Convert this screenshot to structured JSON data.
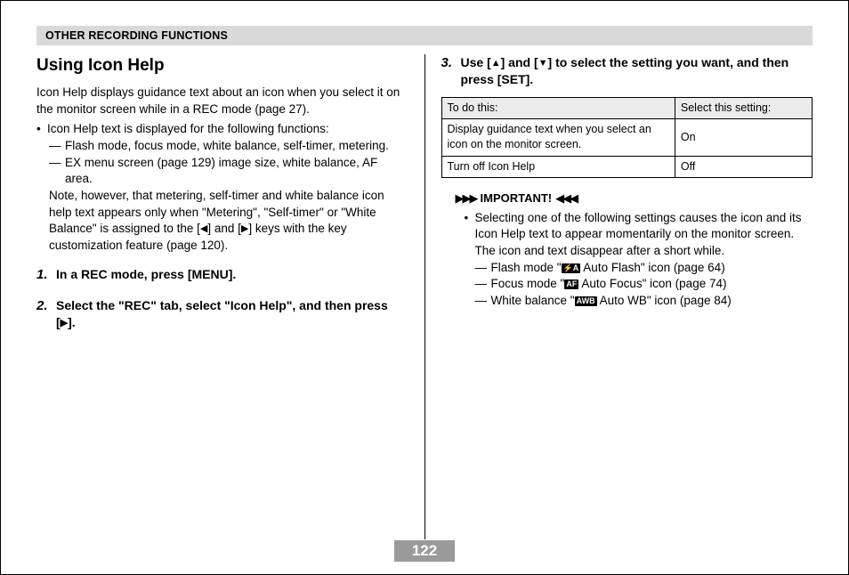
{
  "header": "OTHER RECORDING FUNCTIONS",
  "left": {
    "title": "Using Icon Help",
    "intro": "Icon Help displays guidance text about an icon when you select it on the monitor screen while in a REC mode (page 27).",
    "bullet1": "Icon Help text is displayed for the following functions:",
    "dash1": "Flash mode, focus mode, white balance, self-timer, metering.",
    "dash2": "EX menu screen (page 129) image size, white balance, AF area.",
    "note_pre": "Note, however, that metering, self-timer and white balance icon help text appears only when \"Metering\", \"Self-timer\" or \"White Balance\" is assigned to the [",
    "note_mid": "] and [",
    "note_post": "] keys with the key customization feature (page 120).",
    "step1_num": "1.",
    "step1": "In a REC mode, press [MENU].",
    "step2_num": "2.",
    "step2_pre": "Select the \"REC\" tab, select \"Icon Help\", and then press [",
    "step2_post": "]."
  },
  "right": {
    "step3_num": "3.",
    "step3_pre": "Use [",
    "step3_mid": "] and [",
    "step3_post": "] to select the setting you want, and then press [SET].",
    "table": {
      "h1": "To do this:",
      "h2": "Select this setting:",
      "r1c1": "Display guidance text when you select an icon on the monitor screen.",
      "r1c2": "On",
      "r2c1": "Turn off Icon Help",
      "r2c2": "Off"
    },
    "important": "IMPORTANT!",
    "imp_bullet": "Selecting one of the following settings causes the icon and its Icon Help text to appear momentarily on the monitor screen. The icon and text disappear after a short while.",
    "d1_pre": "Flash mode \"",
    "d1_icon": "⚡A",
    "d1_post": " Auto Flash\" icon (page 64)",
    "d2_pre": "Focus mode \"",
    "d2_icon": "AF",
    "d2_post": " Auto Focus\" icon (page 74)",
    "d3_pre": "White balance \"",
    "d3_icon": "AWB",
    "d3_post": " Auto WB\" icon (page 84)"
  },
  "page_number": "122"
}
